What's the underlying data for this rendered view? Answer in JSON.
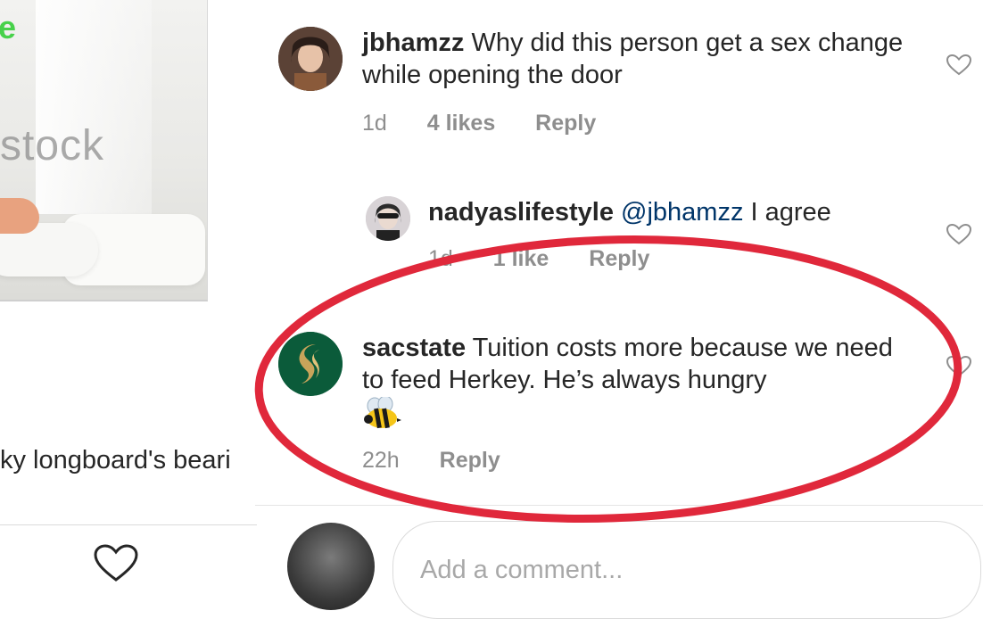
{
  "left_panel": {
    "brand_mark": "e",
    "watermark": "stock",
    "caption": "ky longboard's beari"
  },
  "comments": [
    {
      "username": "jbhamzz",
      "text": "Why did this person get a sex change while opening the door",
      "time": "1d",
      "likes": "4 likes",
      "reply": "Reply"
    },
    {
      "username": "nadyaslifestyle",
      "mention": "@jbhamzz",
      "text": "I agree",
      "time": "1d",
      "likes": "1 like",
      "reply": "Reply"
    },
    {
      "username": "sacstate",
      "text": "Tuition costs more because we need to feed Herkey. He’s always hungry",
      "emoji": "bee-emoji",
      "time": "22h",
      "reply": "Reply"
    }
  ],
  "add_comment": {
    "placeholder": "Add a comment..."
  },
  "icons": {
    "like": "heart-outline-icon",
    "highlight_color": "#e0283b"
  }
}
